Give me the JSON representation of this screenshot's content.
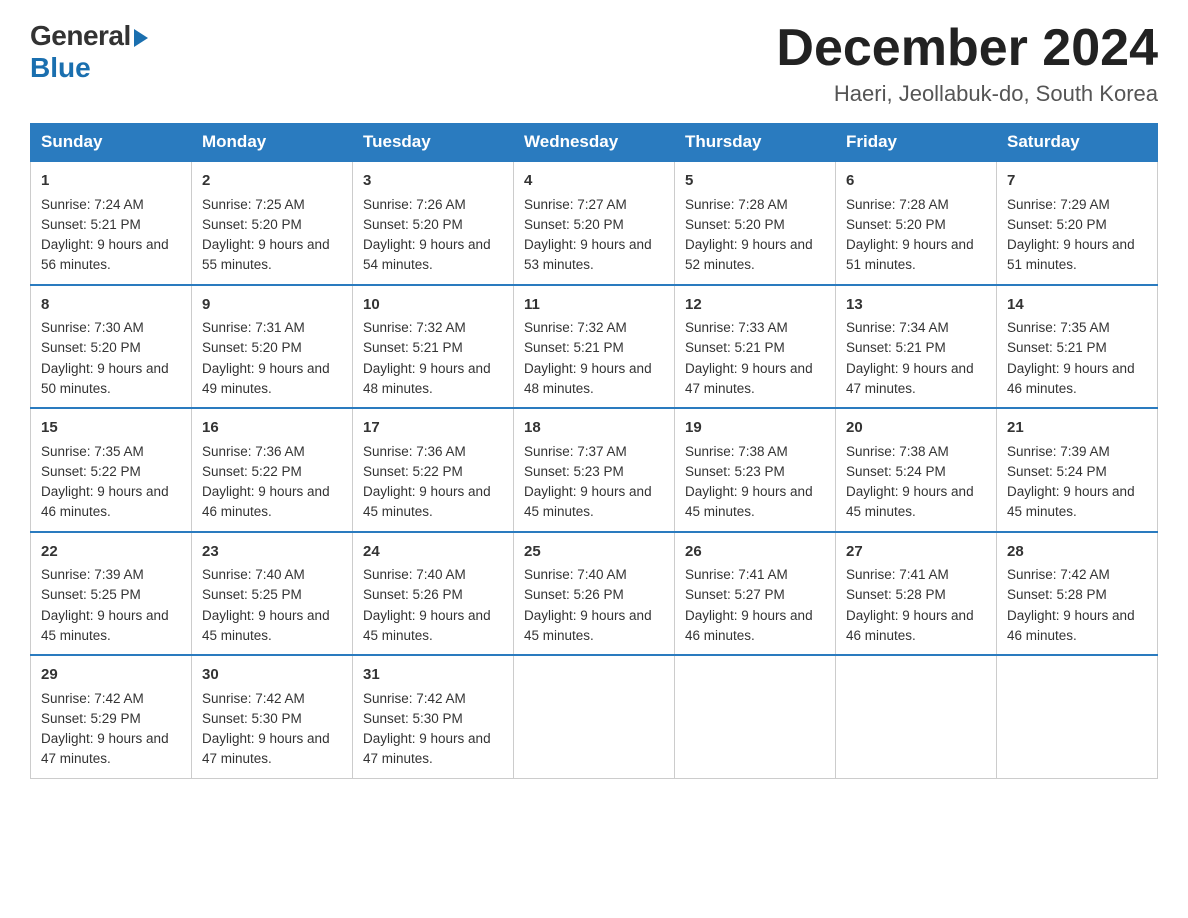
{
  "header": {
    "logo_general": "General",
    "logo_blue": "Blue",
    "month_year": "December 2024",
    "location": "Haeri, Jeollabuk-do, South Korea"
  },
  "days_of_week": [
    "Sunday",
    "Monday",
    "Tuesday",
    "Wednesday",
    "Thursday",
    "Friday",
    "Saturday"
  ],
  "weeks": [
    [
      {
        "day": "1",
        "sunrise": "7:24 AM",
        "sunset": "5:21 PM",
        "daylight": "9 hours and 56 minutes."
      },
      {
        "day": "2",
        "sunrise": "7:25 AM",
        "sunset": "5:20 PM",
        "daylight": "9 hours and 55 minutes."
      },
      {
        "day": "3",
        "sunrise": "7:26 AM",
        "sunset": "5:20 PM",
        "daylight": "9 hours and 54 minutes."
      },
      {
        "day": "4",
        "sunrise": "7:27 AM",
        "sunset": "5:20 PM",
        "daylight": "9 hours and 53 minutes."
      },
      {
        "day": "5",
        "sunrise": "7:28 AM",
        "sunset": "5:20 PM",
        "daylight": "9 hours and 52 minutes."
      },
      {
        "day": "6",
        "sunrise": "7:28 AM",
        "sunset": "5:20 PM",
        "daylight": "9 hours and 51 minutes."
      },
      {
        "day": "7",
        "sunrise": "7:29 AM",
        "sunset": "5:20 PM",
        "daylight": "9 hours and 51 minutes."
      }
    ],
    [
      {
        "day": "8",
        "sunrise": "7:30 AM",
        "sunset": "5:20 PM",
        "daylight": "9 hours and 50 minutes."
      },
      {
        "day": "9",
        "sunrise": "7:31 AM",
        "sunset": "5:20 PM",
        "daylight": "9 hours and 49 minutes."
      },
      {
        "day": "10",
        "sunrise": "7:32 AM",
        "sunset": "5:21 PM",
        "daylight": "9 hours and 48 minutes."
      },
      {
        "day": "11",
        "sunrise": "7:32 AM",
        "sunset": "5:21 PM",
        "daylight": "9 hours and 48 minutes."
      },
      {
        "day": "12",
        "sunrise": "7:33 AM",
        "sunset": "5:21 PM",
        "daylight": "9 hours and 47 minutes."
      },
      {
        "day": "13",
        "sunrise": "7:34 AM",
        "sunset": "5:21 PM",
        "daylight": "9 hours and 47 minutes."
      },
      {
        "day": "14",
        "sunrise": "7:35 AM",
        "sunset": "5:21 PM",
        "daylight": "9 hours and 46 minutes."
      }
    ],
    [
      {
        "day": "15",
        "sunrise": "7:35 AM",
        "sunset": "5:22 PM",
        "daylight": "9 hours and 46 minutes."
      },
      {
        "day": "16",
        "sunrise": "7:36 AM",
        "sunset": "5:22 PM",
        "daylight": "9 hours and 46 minutes."
      },
      {
        "day": "17",
        "sunrise": "7:36 AM",
        "sunset": "5:22 PM",
        "daylight": "9 hours and 45 minutes."
      },
      {
        "day": "18",
        "sunrise": "7:37 AM",
        "sunset": "5:23 PM",
        "daylight": "9 hours and 45 minutes."
      },
      {
        "day": "19",
        "sunrise": "7:38 AM",
        "sunset": "5:23 PM",
        "daylight": "9 hours and 45 minutes."
      },
      {
        "day": "20",
        "sunrise": "7:38 AM",
        "sunset": "5:24 PM",
        "daylight": "9 hours and 45 minutes."
      },
      {
        "day": "21",
        "sunrise": "7:39 AM",
        "sunset": "5:24 PM",
        "daylight": "9 hours and 45 minutes."
      }
    ],
    [
      {
        "day": "22",
        "sunrise": "7:39 AM",
        "sunset": "5:25 PM",
        "daylight": "9 hours and 45 minutes."
      },
      {
        "day": "23",
        "sunrise": "7:40 AM",
        "sunset": "5:25 PM",
        "daylight": "9 hours and 45 minutes."
      },
      {
        "day": "24",
        "sunrise": "7:40 AM",
        "sunset": "5:26 PM",
        "daylight": "9 hours and 45 minutes."
      },
      {
        "day": "25",
        "sunrise": "7:40 AM",
        "sunset": "5:26 PM",
        "daylight": "9 hours and 45 minutes."
      },
      {
        "day": "26",
        "sunrise": "7:41 AM",
        "sunset": "5:27 PM",
        "daylight": "9 hours and 46 minutes."
      },
      {
        "day": "27",
        "sunrise": "7:41 AM",
        "sunset": "5:28 PM",
        "daylight": "9 hours and 46 minutes."
      },
      {
        "day": "28",
        "sunrise": "7:42 AM",
        "sunset": "5:28 PM",
        "daylight": "9 hours and 46 minutes."
      }
    ],
    [
      {
        "day": "29",
        "sunrise": "7:42 AM",
        "sunset": "5:29 PM",
        "daylight": "9 hours and 47 minutes."
      },
      {
        "day": "30",
        "sunrise": "7:42 AM",
        "sunset": "5:30 PM",
        "daylight": "9 hours and 47 minutes."
      },
      {
        "day": "31",
        "sunrise": "7:42 AM",
        "sunset": "5:30 PM",
        "daylight": "9 hours and 47 minutes."
      },
      null,
      null,
      null,
      null
    ]
  ]
}
